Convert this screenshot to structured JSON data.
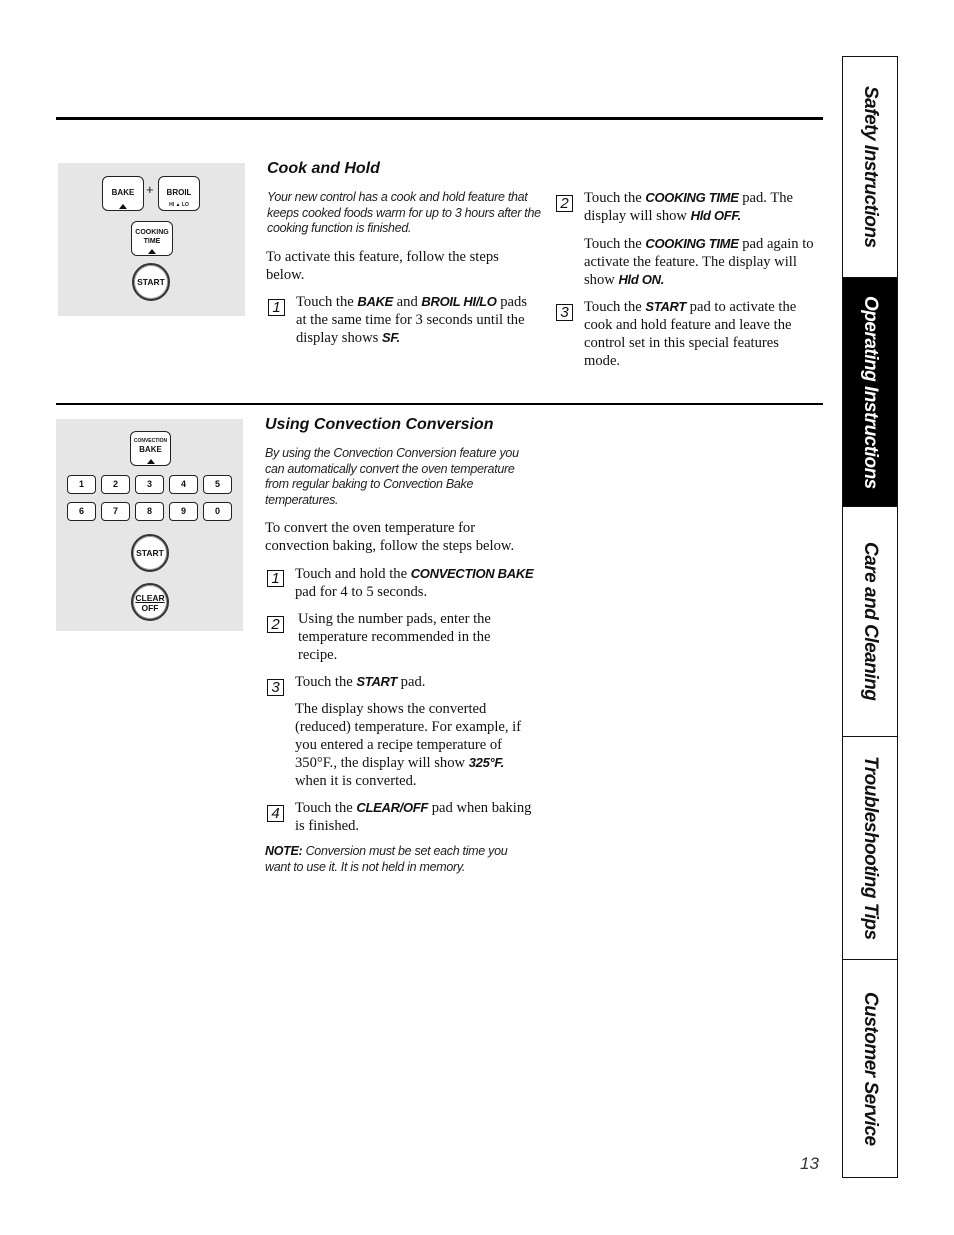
{
  "section1": {
    "title": "Cook and Hold",
    "intro": "Your new control has a cook and hold feature that keeps cooked foods warm for up to 3 hours after the cooking function is finished.",
    "lead": "To activate this feature, follow the steps below.",
    "pads": {
      "bake": "BAKE",
      "plus": "+",
      "broil": "BROIL",
      "broil_sub": "HI ▲ LO",
      "cooking_time_1": "COOKING",
      "cooking_time_2": "TIME",
      "start": "START"
    },
    "steps": [
      {
        "num": "1",
        "parts": [
          "Touch the ",
          "BAKE",
          " and ",
          "BROIL HI/LO",
          " pads at the same time for 3 seconds until the display shows ",
          "SF."
        ]
      },
      {
        "num": "2",
        "parts": [
          "Touch the ",
          "COOKING TIME",
          " pad. The display will show ",
          "Hld OFF."
        ],
        "extra": [
          "Touch the ",
          "COOKING TIME",
          " pad again to activate the feature. The display will show ",
          "Hld ON."
        ]
      },
      {
        "num": "3",
        "parts": [
          "Touch the ",
          "START",
          " pad to activate the cook and hold feature and leave the control set in this special features mode."
        ]
      }
    ]
  },
  "section2": {
    "title": "Using Convection Conversion",
    "intro": "By using the Convection Conversion feature you can automatically convert the oven temperature from regular baking to Convection Bake temperatures.",
    "lead": "To convert the oven temperature for convection baking, follow the steps below.",
    "pads": {
      "conv_1": "CONVECTION",
      "conv_2": "BAKE",
      "numbers": [
        "1",
        "2",
        "3",
        "4",
        "5",
        "6",
        "7",
        "8",
        "9",
        "0"
      ],
      "start": "START",
      "clear_1": "CLEAR",
      "clear_2": "OFF"
    },
    "steps": [
      {
        "num": "1",
        "parts": [
          "Touch and hold the ",
          "CONVECTION BAKE",
          " pad for 4 to 5 seconds."
        ]
      },
      {
        "num": "2",
        "parts": [
          "Using the number pads, enter the temperature recommended in the recipe."
        ]
      },
      {
        "num": "3",
        "parts": [
          "Touch the ",
          "START",
          " pad."
        ],
        "extra": [
          "The display shows the converted (reduced) temperature. For example, if you entered a recipe temperature of 350°F., the display will show ",
          "325°F.",
          " when it is converted."
        ]
      },
      {
        "num": "4",
        "parts": [
          "Touch the ",
          "CLEAR/OFF",
          " pad when baking is finished."
        ]
      }
    ],
    "note_label": "NOTE:",
    "note_text": " Conversion must be set each time you want to use it. It is not held in memory."
  },
  "sidetabs": [
    {
      "label": "Safety Instructions",
      "active": false
    },
    {
      "label": "Operating Instructions",
      "active": true
    },
    {
      "label": "Care and Cleaning",
      "active": false
    },
    {
      "label": "Troubleshooting Tips",
      "active": false
    },
    {
      "label": "Customer Service",
      "active": false
    }
  ],
  "page_number": "13"
}
